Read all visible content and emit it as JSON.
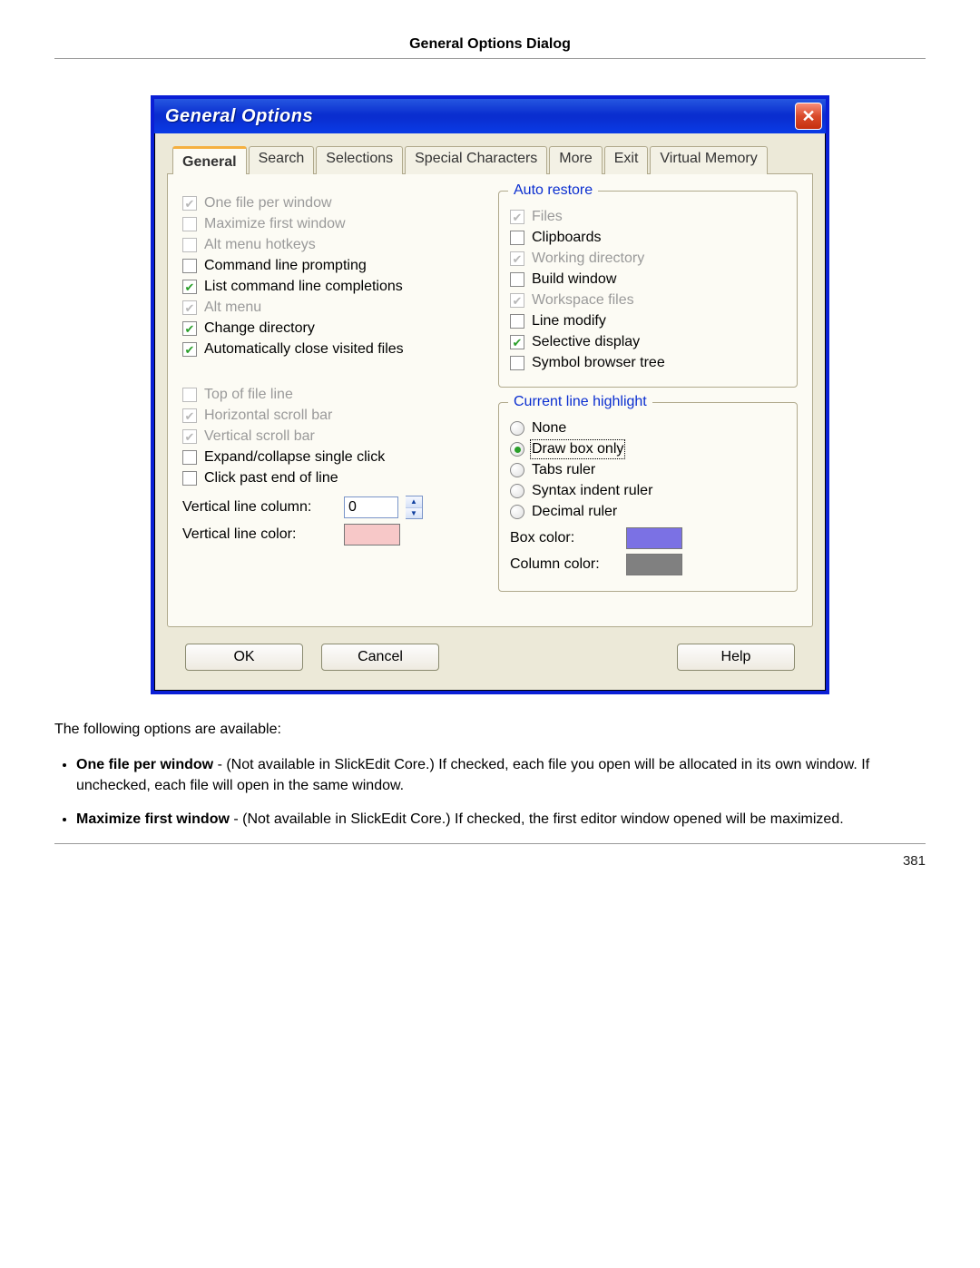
{
  "pageHeader": "General Options Dialog",
  "pageNumber": "381",
  "dialog": {
    "title": "General Options",
    "tabs": [
      "General",
      "Search",
      "Selections",
      "Special Characters",
      "More",
      "Exit",
      "Virtual Memory"
    ],
    "activeTab": "General",
    "leftTop": [
      {
        "label": "One file per window",
        "checked": true,
        "disabled": true
      },
      {
        "label": "Maximize first window",
        "checked": false,
        "disabled": true
      },
      {
        "label": "Alt menu hotkeys",
        "checked": false,
        "disabled": true
      },
      {
        "label": "Command line prompting",
        "checked": false,
        "disabled": false
      },
      {
        "label": "List command line completions",
        "checked": true,
        "disabled": false
      },
      {
        "label": "Alt menu",
        "checked": true,
        "disabled": true
      },
      {
        "label": "Change directory",
        "checked": true,
        "disabled": false
      },
      {
        "label": "Automatically close visited files",
        "checked": true,
        "disabled": false
      }
    ],
    "leftBottom": [
      {
        "label": "Top of file line",
        "checked": false,
        "disabled": true
      },
      {
        "label": "Horizontal scroll bar",
        "checked": true,
        "disabled": true
      },
      {
        "label": "Vertical scroll bar",
        "checked": true,
        "disabled": true
      },
      {
        "label": "Expand/collapse single click",
        "checked": false,
        "disabled": false
      },
      {
        "label": "Click past end of line",
        "checked": false,
        "disabled": false
      }
    ],
    "verticalLineColumnLabel": "Vertical line column:",
    "verticalLineColumnValue": "0",
    "verticalLineColorLabel": "Vertical line color:",
    "verticalLineColor": "#f7c8c8",
    "autoRestore": {
      "legend": "Auto restore",
      "items": [
        {
          "label": "Files",
          "checked": true,
          "disabled": true
        },
        {
          "label": "Clipboards",
          "checked": false,
          "disabled": false
        },
        {
          "label": "Working directory",
          "checked": true,
          "disabled": true
        },
        {
          "label": "Build window",
          "checked": false,
          "disabled": false
        },
        {
          "label": "Workspace files",
          "checked": true,
          "disabled": true
        },
        {
          "label": "Line modify",
          "checked": false,
          "disabled": false
        },
        {
          "label": "Selective display",
          "checked": true,
          "disabled": false
        },
        {
          "label": "Symbol browser tree",
          "checked": false,
          "disabled": false
        }
      ]
    },
    "currentLine": {
      "legend": "Current line highlight",
      "radios": [
        "None",
        "Draw box only",
        "Tabs ruler",
        "Syntax indent ruler",
        "Decimal ruler"
      ],
      "selected": "Draw box only",
      "boxColorLabel": "Box color:",
      "boxColor": "#7b71e4",
      "columnColorLabel": "Column color:",
      "columnColor": "#808080"
    },
    "buttons": {
      "ok": "OK",
      "cancel": "Cancel",
      "help": "Help"
    }
  },
  "descIntro": "The following options are available:",
  "bullets": [
    {
      "term": "One file per window",
      "rest": " - (Not available in SlickEdit Core.) If checked, each file you open will be allocated in its own window. If unchecked, each file will open in the same window."
    },
    {
      "term": "Maximize first window",
      "rest": " - (Not available in SlickEdit Core.) If checked, the first editor window opened will be maximized."
    }
  ]
}
